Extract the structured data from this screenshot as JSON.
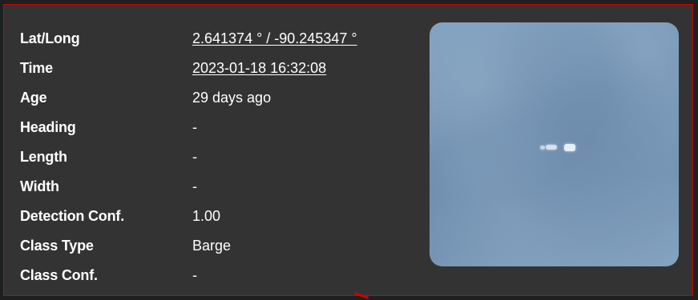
{
  "details": [
    {
      "label": "Lat/Long",
      "value": "2.641374 ° / -90.245347 °",
      "link": true
    },
    {
      "label": "Time",
      "value": "2023-01-18 16:32:08",
      "link": true
    },
    {
      "label": "Age",
      "value": "29 days ago",
      "link": false
    },
    {
      "label": "Heading",
      "value": "-",
      "link": false
    },
    {
      "label": "Length",
      "value": "-",
      "link": false
    },
    {
      "label": "Width",
      "value": "-",
      "link": false
    },
    {
      "label": "Detection Conf.",
      "value": "1.00",
      "link": false
    },
    {
      "label": "Class Type",
      "value": "Barge",
      "link": false
    },
    {
      "label": "Class Conf.",
      "value": "-",
      "link": false
    }
  ],
  "colors": {
    "panel_background": "#333333",
    "panel_border": "#d40000",
    "text": "#ffffff"
  }
}
